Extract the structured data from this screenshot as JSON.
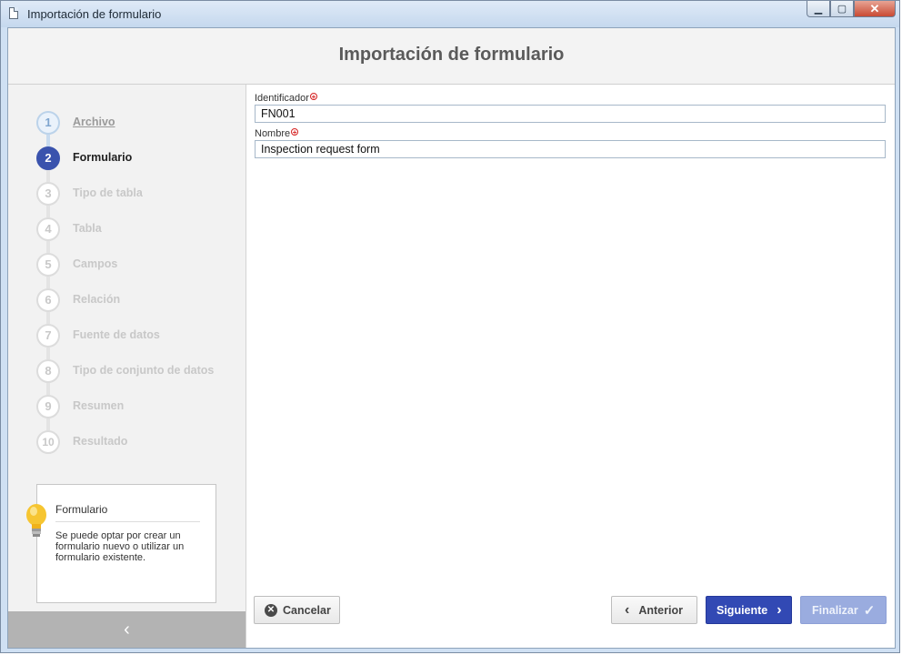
{
  "window": {
    "title": "Importación de formulario",
    "controls": {
      "minimize": "▭",
      "maximize": "□",
      "close": "✕"
    }
  },
  "header": {
    "title": "Importación de formulario"
  },
  "steps": [
    {
      "num": "1",
      "label": "Archivo",
      "state": "done"
    },
    {
      "num": "2",
      "label": "Formulario",
      "state": "active"
    },
    {
      "num": "3",
      "label": "Tipo de tabla",
      "state": "pending"
    },
    {
      "num": "4",
      "label": "Tabla",
      "state": "pending"
    },
    {
      "num": "5",
      "label": "Campos",
      "state": "pending"
    },
    {
      "num": "6",
      "label": "Relación",
      "state": "pending"
    },
    {
      "num": "7",
      "label": "Fuente de datos",
      "state": "pending"
    },
    {
      "num": "8",
      "label": "Tipo de conjunto de datos",
      "state": "pending"
    },
    {
      "num": "9",
      "label": "Resumen",
      "state": "pending"
    },
    {
      "num": "10",
      "label": "Resultado",
      "state": "pending"
    }
  ],
  "info": {
    "title": "Formulario",
    "text": "Se puede optar por crear un formulario nuevo o utilizar un formulario existente.",
    "icon": "lightbulb-icon"
  },
  "sidebar": {
    "collapse_glyph": "‹"
  },
  "form": {
    "id_label": "Identificador",
    "id_value": "FN001",
    "name_label": "Nombre",
    "name_value": "Inspection request form",
    "required_glyph": "✱"
  },
  "buttons": {
    "cancel": "Cancelar",
    "previous": "Anterior",
    "next": "Siguiente",
    "finish": "Finalizar"
  },
  "colors": {
    "active_step": "#3a53ad",
    "next_button": "#3249b4",
    "finish_button_disabled": "#9aacdf",
    "required": "#d52020"
  }
}
